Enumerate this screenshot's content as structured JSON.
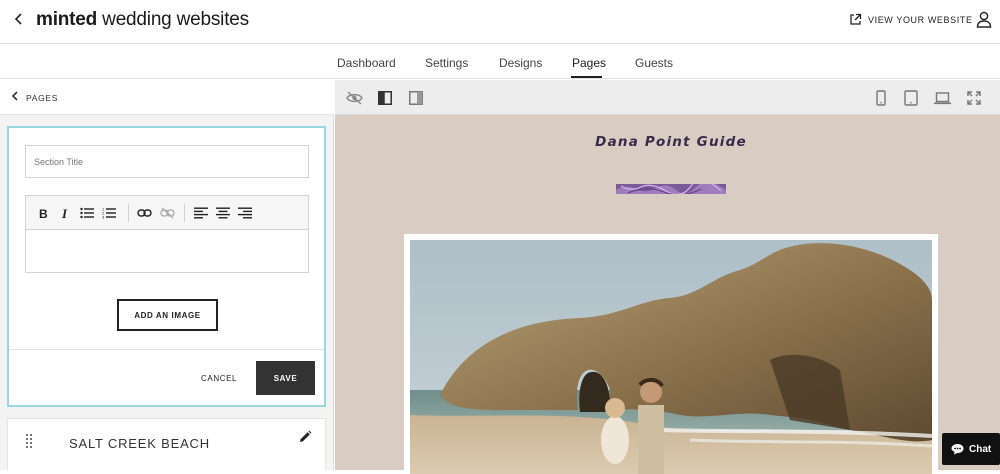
{
  "header": {
    "brand_bold": "minted",
    "brand_rest": " wedding websites",
    "view_website": "VIEW YOUR WEBSITE"
  },
  "tabs": [
    {
      "label": "Dashboard"
    },
    {
      "label": "Settings"
    },
    {
      "label": "Designs"
    },
    {
      "label": "Pages",
      "active": true
    },
    {
      "label": "Guests"
    }
  ],
  "sidebar": {
    "back_label": "PAGES",
    "editor": {
      "section_title_placeholder": "Section Title",
      "section_title_value": "",
      "add_image_label": "ADD AN IMAGE",
      "cancel_label": "CANCEL",
      "save_label": "SAVE"
    },
    "sections": [
      {
        "label": "SALT CREEK BEACH"
      }
    ]
  },
  "preview": {
    "page_title": "Dana Point Guide",
    "accent_color": "#3a2a4a",
    "background_color": "#d9cdc3"
  },
  "chat": {
    "label": "Chat"
  }
}
